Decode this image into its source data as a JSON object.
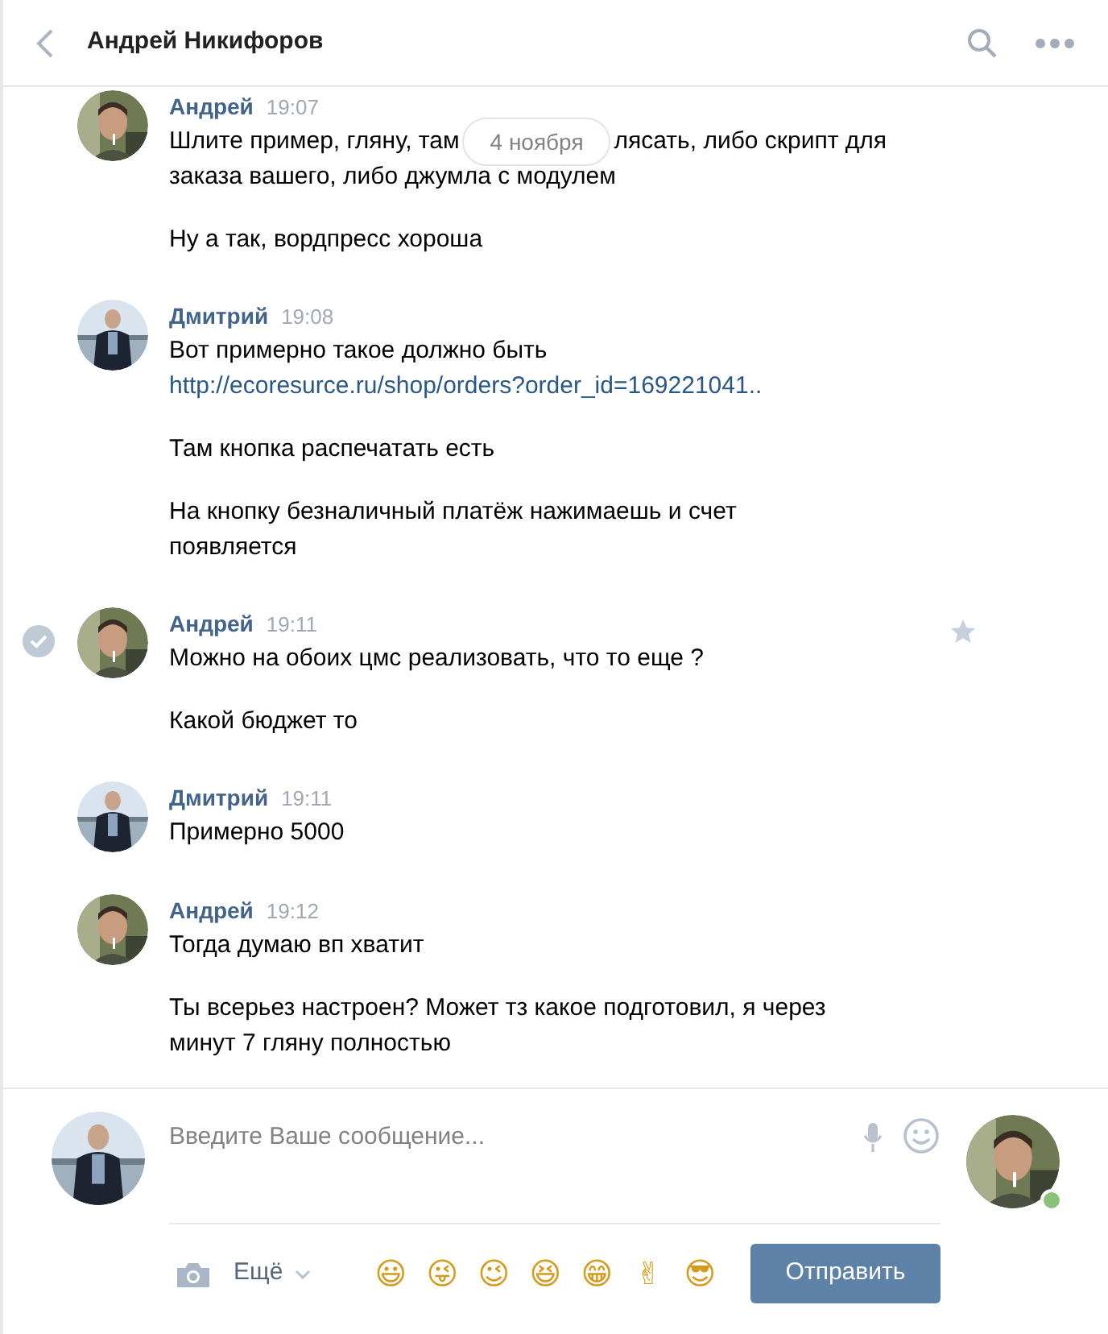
{
  "header": {
    "title": "Андрей Никифоров"
  },
  "date_pill": "4 ноября",
  "messages": [
    {
      "author": "Андрей",
      "kind": "peer",
      "time": "19:07",
      "selected": false,
      "paragraphs": [
        [
          {
            "kind": "text",
            "text": "Шлите пример, гляну, там"
          },
          {
            "kind": "text",
            "text": "лясать, либо скрипт для"
          },
          {
            "kind": "text",
            "text": "заказа вашего, либо джумла с модулем"
          }
        ],
        [
          {
            "kind": "text",
            "text": "Ну а так, вордпресс хороша"
          }
        ]
      ]
    },
    {
      "author": "Дмитрий",
      "kind": "self",
      "time": "19:08",
      "selected": false,
      "paragraphs": [
        [
          {
            "kind": "text",
            "text": "Вот примерно такое должно быть"
          },
          {
            "kind": "link",
            "text": "http://ecoresurce.ru/shop/orders?order_id=169221041.."
          }
        ],
        [
          {
            "kind": "text",
            "text": "Там кнопка распечатать есть"
          }
        ],
        [
          {
            "kind": "text",
            "text": "На кнопку безналичный платёж нажимаешь и счет появляется"
          }
        ]
      ]
    },
    {
      "author": "Андрей",
      "kind": "peer",
      "time": "19:11",
      "selected": true,
      "paragraphs": [
        [
          {
            "kind": "text",
            "text": "Можно на обоих цмс реализовать, что то еще ?"
          }
        ],
        [
          {
            "kind": "text",
            "text": "Какой бюджет то"
          }
        ]
      ]
    },
    {
      "author": "Дмитрий",
      "kind": "self",
      "time": "19:11",
      "selected": false,
      "paragraphs": [
        [
          {
            "kind": "text",
            "text": "Примерно 5000"
          }
        ]
      ]
    },
    {
      "author": "Андрей",
      "kind": "peer",
      "time": "19:12",
      "selected": false,
      "paragraphs": [
        [
          {
            "kind": "text",
            "text": "Тогда думаю вп хватит"
          }
        ],
        [
          {
            "kind": "text",
            "text": "Ты всерьез настроен? Может тз какое подготовил, я через минут 7 гляну полностью"
          }
        ]
      ]
    }
  ],
  "composer": {
    "placeholder": "Введите Ваше сообщение...",
    "more": "Ещё",
    "emojis": [
      "😃",
      "😜",
      "😉",
      "😆",
      "😁",
      "✌",
      "😎"
    ],
    "send": "Отправить",
    "peer_online": true
  }
}
